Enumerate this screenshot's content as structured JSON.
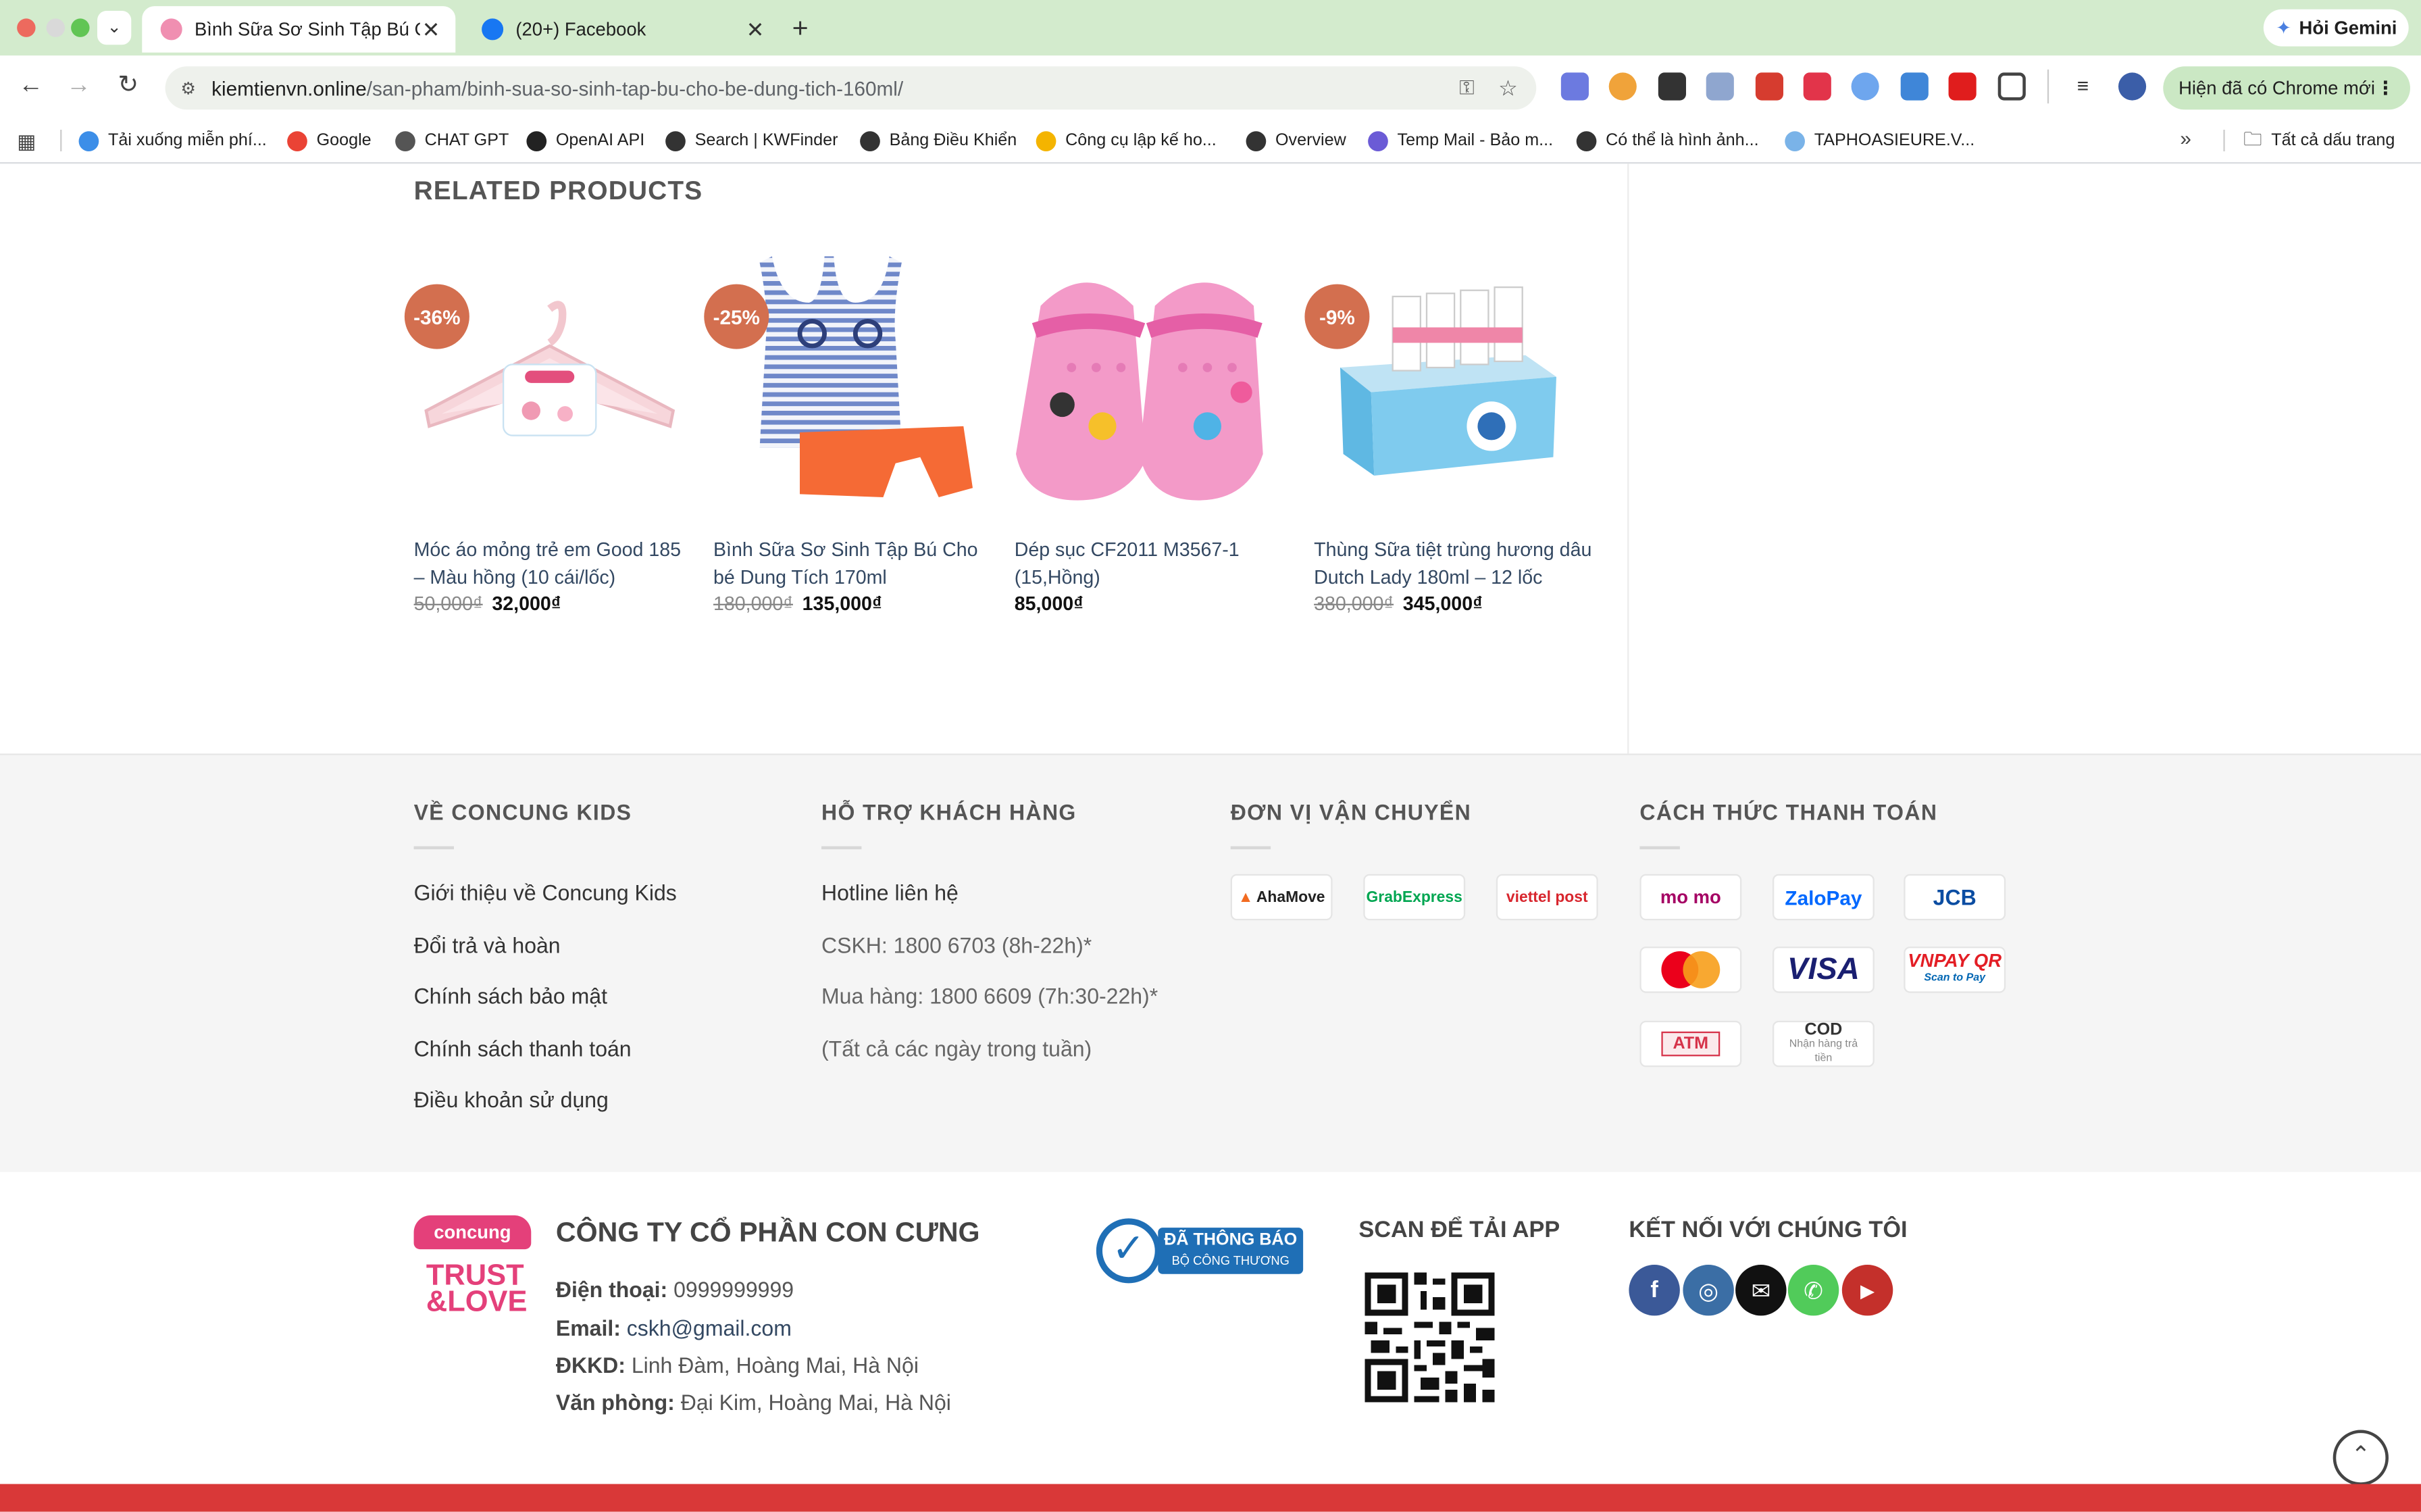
{
  "browser": {
    "tabs": [
      {
        "title": "Bình Sữa Sơ Sinh Tập Bú Cho"
      },
      {
        "title": "(20+) Facebook"
      }
    ],
    "new_tab": "+",
    "gemini": "Hỏi Gemini",
    "url_host": "kiemtienvn.online",
    "url_path": "/san-pham/binh-sua-so-sinh-tap-bu-cho-be-dung-tich-160ml/",
    "update_button": "Hiện đã có Chrome mới",
    "bookmarks": [
      "Tải xuống miễn phí...",
      "Google",
      "CHAT GPT",
      "OpenAI API",
      "Search | KWFinder",
      "Bảng Điều Khiển",
      "Công cụ lập kế ho...",
      "Overview",
      "Temp Mail - Bảo m...",
      "Có thể là hình ảnh...",
      "TAPHOASIEURE.V..."
    ],
    "all_bookmarks": "Tất cả dấu trang"
  },
  "related": {
    "heading": "RELATED PRODUCTS",
    "products": [
      {
        "badge": "-36%",
        "name": "Móc áo mỏng trẻ em Good 185 – Màu hồng (10 cái/lốc)",
        "old_price": "50,000₫",
        "price": "32,000₫"
      },
      {
        "badge": "-25%",
        "name": "Bình Sữa Sơ Sinh Tập Bú Cho bé Dung Tích 170ml",
        "old_price": "180,000₫",
        "price": "135,000₫"
      },
      {
        "badge": "",
        "name": "Dép sục CF2011 M3567-1 (15,Hồng)",
        "old_price": "",
        "price": "85,000₫"
      },
      {
        "badge": "-9%",
        "name": "Thùng Sữa tiệt trùng hương dâu Dutch Lady 180ml – 12 lốc",
        "old_price": "380,000₫",
        "price": "345,000₫"
      }
    ]
  },
  "footer": {
    "about": {
      "title": "VỀ CONCUNG KIDS",
      "links": [
        "Giới thiệu về Concung Kids",
        "Đổi trả và hoàn",
        "Chính sách bảo mật",
        "Chính sách thanh toán",
        "Điều khoản sử dụng"
      ]
    },
    "support": {
      "title": "HỖ TRỢ KHÁCH HÀNG",
      "lines": [
        "Hotline liên hệ",
        "CSKH: 1800 6703 (8h-22h)*",
        "Mua hàng: 1800 6609 (7h:30-22h)*",
        "(Tất cả các ngày trong tuần)"
      ]
    },
    "shipping": {
      "title": "ĐƠN VỊ VẬN CHUYỂN",
      "logos": [
        "AhaMove",
        "GrabExpress",
        "viettel post"
      ]
    },
    "payment": {
      "title": "CÁCH THỨC THANH TOÁN",
      "logos": [
        "mo mo",
        "ZaloPay",
        "JCB",
        "MasterCard",
        "VISA",
        "VNPAY QR",
        "ATM",
        "COD"
      ],
      "vnpay_sub": "Scan to Pay",
      "cod_sub": "Nhận hàng trả tiền"
    },
    "company": {
      "logo_top": "concung",
      "logo_line1": "TRUST",
      "logo_line2": "&LOVE",
      "name": "CÔNG TY CỔ PHẦN CON CƯNG",
      "phone_label": "Điện thoại:",
      "phone": "0999999999",
      "email_label": "Email:",
      "email": "cskh@gmail.com",
      "dkkd_label": "ĐKKD:",
      "dkkd": "Linh Đàm, Hoàng Mai, Hà Nội",
      "office_label": "Văn phòng:",
      "office": "Đại Kim, Hoàng Mai, Hà Nội"
    },
    "cert": {
      "title": "ĐÃ THÔNG BÁO",
      "sub": "BỘ CÔNG THƯƠNG"
    },
    "app": {
      "title": "SCAN ĐỂ TẢI APP"
    },
    "social": {
      "title": "KẾT NỐI VỚI CHÚNG TÔI",
      "icons": [
        "facebook-icon",
        "instagram-icon",
        "email-icon",
        "phone-icon",
        "youtube-icon"
      ]
    }
  },
  "colors": {
    "badge": "#d36f4f",
    "link": "#334862",
    "brand_red": "#d93838",
    "chrome_tab": "#d3ebcd"
  }
}
